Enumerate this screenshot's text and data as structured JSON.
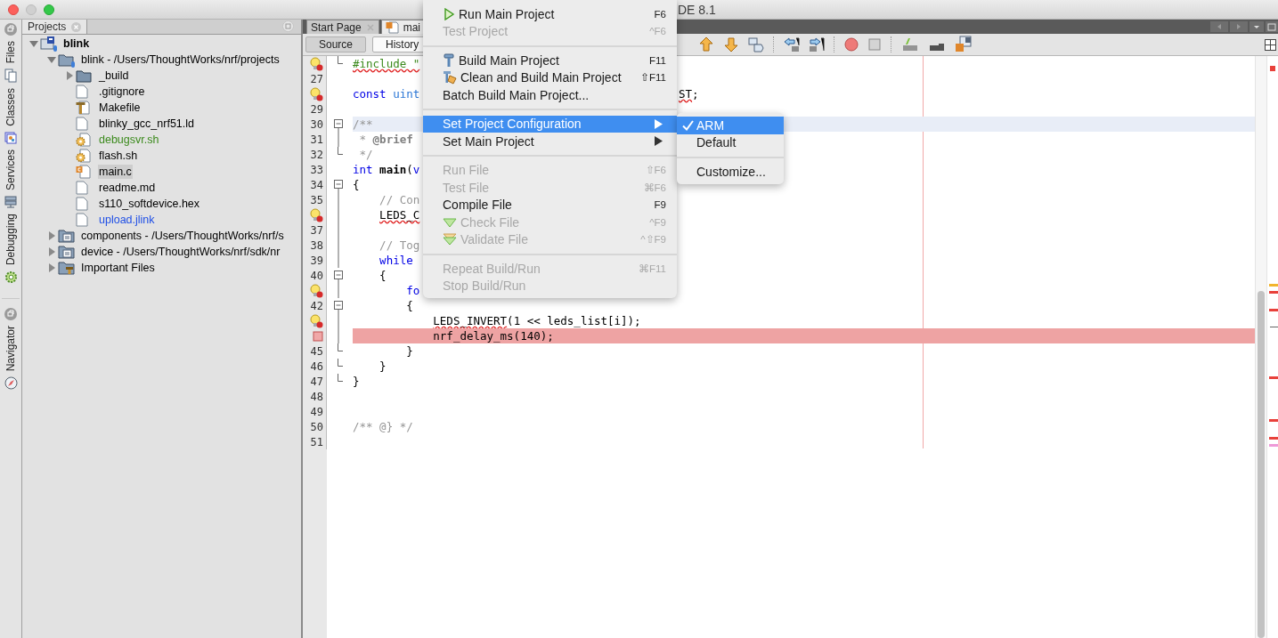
{
  "window": {
    "title": "DE 8.1"
  },
  "side_tabs": [
    {
      "label": "Files",
      "kind": "files"
    },
    {
      "label": "Classes",
      "kind": "classes"
    },
    {
      "label": "Services",
      "kind": "services"
    },
    {
      "label": "Debugging",
      "kind": "debugging"
    },
    {
      "label": "Navigator",
      "kind": "navigator"
    }
  ],
  "projects": {
    "title": "Projects",
    "tree": [
      {
        "label": "blink",
        "kind": "project",
        "expanded": true,
        "selected": false,
        "children": [
          {
            "label": "blink - /Users/ThoughtWorks/nrf/projects",
            "kind": "source-root",
            "expanded": true,
            "selected": false,
            "children": [
              {
                "label": "_build",
                "kind": "folder",
                "expanded": false,
                "selected": false
              },
              {
                "label": ".gitignore",
                "kind": "file",
                "selected": false
              },
              {
                "label": "Makefile",
                "kind": "makefile",
                "selected": false
              },
              {
                "label": "blinky_gcc_nrf51.ld",
                "kind": "file",
                "selected": false
              },
              {
                "label": "debugsvr.sh",
                "kind": "script",
                "color": "#3b8a1c",
                "selected": false
              },
              {
                "label": "flash.sh",
                "kind": "script",
                "selected": false
              },
              {
                "label": "main.c",
                "kind": "c-file",
                "selected": true
              },
              {
                "label": "readme.md",
                "kind": "file",
                "selected": false
              },
              {
                "label": "s110_softdevice.hex",
                "kind": "file",
                "selected": false
              },
              {
                "label": "upload.jlink",
                "kind": "file",
                "color": "#1f4fe6",
                "selected": false
              }
            ]
          },
          {
            "label": "components - /Users/ThoughtWorks/nrf/s",
            "kind": "library",
            "expanded": false,
            "selected": false
          },
          {
            "label": "device - /Users/ThoughtWorks/nrf/sdk/nr",
            "kind": "library",
            "expanded": false,
            "selected": false
          },
          {
            "label": "Important Files",
            "kind": "important",
            "expanded": false,
            "selected": false
          }
        ]
      }
    ]
  },
  "editor": {
    "tabs": [
      {
        "label": "Start Page",
        "selected": false,
        "kind": "page"
      },
      {
        "label": "mai",
        "selected": true,
        "kind": "c-file"
      }
    ],
    "views": [
      {
        "label": "Source",
        "selected": true
      },
      {
        "label": "History",
        "selected": false
      }
    ],
    "lines": [
      {
        "hint": true,
        "breakpoint": false,
        "fold_start": false,
        "fold_end": true,
        "current": false,
        "tokens": [
          {
            "text": "#include \"",
            "kind": "include-error"
          }
        ]
      },
      {
        "number": "27",
        "hint": false,
        "breakpoint": false,
        "fold_start": false,
        "fold_end": false,
        "current": false
      },
      {
        "hint": true,
        "breakpoint": false,
        "fold_start": false,
        "fold_end": false,
        "current": false,
        "tokens": [
          {
            "text": "const",
            "kind": "kw"
          },
          {
            "text": " uint",
            "kind": "type"
          }
        ],
        "tail": [
          {
            "text": "ST",
            "kind": "error"
          },
          {
            "text": ";",
            "kind": "plain"
          }
        ]
      },
      {
        "number": "29",
        "hint": false,
        "breakpoint": false,
        "fold_start": false,
        "fold_end": false,
        "current": false
      },
      {
        "number": "30",
        "hint": false,
        "breakpoint": false,
        "fold_start": true,
        "fold_end": false,
        "current": true,
        "tokens": [
          {
            "text": "/**",
            "kind": "comment"
          }
        ]
      },
      {
        "number": "31",
        "hint": false,
        "breakpoint": false,
        "fold_start": false,
        "fold_end": false,
        "current": false,
        "tokens": [
          {
            "text": " *",
            "kind": "comment"
          },
          {
            "text": " @brief",
            "kind": "doc-tag"
          }
        ]
      },
      {
        "number": "32",
        "hint": false,
        "breakpoint": false,
        "fold_start": false,
        "fold_end": true,
        "current": false,
        "tokens": [
          {
            "text": " */",
            "kind": "comment"
          }
        ]
      },
      {
        "number": "33",
        "hint": false,
        "breakpoint": false,
        "fold_start": false,
        "fold_end": false,
        "current": false,
        "tokens": [
          {
            "text": "int",
            "kind": "kw"
          },
          {
            "text": " main",
            "kind": "bold"
          },
          {
            "text": "(",
            "kind": "plain"
          },
          {
            "text": "v",
            "kind": "kw"
          }
        ]
      },
      {
        "number": "34",
        "hint": false,
        "breakpoint": false,
        "fold_start": true,
        "fold_end": false,
        "current": false,
        "tokens": [
          {
            "text": "{",
            "kind": "plain"
          }
        ]
      },
      {
        "number": "35",
        "hint": false,
        "breakpoint": false,
        "fold_start": false,
        "fold_end": false,
        "current": false,
        "tokens": [
          {
            "text": "    // Con",
            "kind": "comment"
          }
        ]
      },
      {
        "hint": true,
        "breakpoint": false,
        "fold_start": false,
        "fold_end": false,
        "current": false,
        "tokens": [
          {
            "text": "    LEDS_C",
            "kind": "error"
          }
        ]
      },
      {
        "number": "37",
        "hint": false,
        "breakpoint": false,
        "fold_start": false,
        "fold_end": false,
        "current": false
      },
      {
        "number": "38",
        "hint": false,
        "breakpoint": false,
        "fold_start": false,
        "fold_end": false,
        "current": false,
        "tokens": [
          {
            "text": "    // Tog",
            "kind": "comment"
          }
        ]
      },
      {
        "number": "39",
        "hint": false,
        "breakpoint": false,
        "fold_start": false,
        "fold_end": false,
        "current": false,
        "tokens": [
          {
            "text": "    while",
            "kind": "kw"
          }
        ]
      },
      {
        "number": "40",
        "hint": false,
        "breakpoint": false,
        "fold_start": true,
        "fold_end": false,
        "current": false,
        "tokens": [
          {
            "text": "    {",
            "kind": "plain"
          }
        ]
      },
      {
        "hint": true,
        "breakpoint": false,
        "fold_start": false,
        "fold_end": false,
        "current": false,
        "tokens": [
          {
            "text": "        fo",
            "kind": "kw"
          }
        ]
      },
      {
        "number": "42",
        "hint": false,
        "breakpoint": false,
        "fold_start": true,
        "fold_end": false,
        "current": false,
        "tokens": [
          {
            "text": "        {",
            "kind": "plain"
          }
        ]
      },
      {
        "hint": true,
        "breakpoint": false,
        "fold_start": false,
        "fold_end": false,
        "current": false,
        "tokens": [
          {
            "text": "            LEDS_INVERT",
            "kind": "error"
          },
          {
            "text": "(1 << leds_list[i]);",
            "kind": "plain"
          }
        ]
      },
      {
        "hint": false,
        "breakpoint": true,
        "fold_start": false,
        "fold_end": false,
        "current": false,
        "tokens": [
          {
            "text": "            nrf_delay_ms(140);",
            "kind": "plain"
          }
        ]
      },
      {
        "number": "45",
        "hint": false,
        "breakpoint": false,
        "fold_start": false,
        "fold_end": true,
        "current": false,
        "tokens": [
          {
            "text": "        }",
            "kind": "plain"
          }
        ]
      },
      {
        "number": "46",
        "hint": false,
        "breakpoint": false,
        "fold_start": false,
        "fold_end": true,
        "current": false,
        "tokens": [
          {
            "text": "    }",
            "kind": "plain"
          }
        ]
      },
      {
        "number": "47",
        "hint": false,
        "breakpoint": false,
        "fold_start": false,
        "fold_end": true,
        "current": false,
        "tokens": [
          {
            "text": "}",
            "kind": "plain"
          }
        ]
      },
      {
        "number": "48",
        "hint": false,
        "breakpoint": false,
        "fold_start": false,
        "fold_end": false,
        "current": false
      },
      {
        "number": "49",
        "hint": false,
        "breakpoint": false,
        "fold_start": false,
        "fold_end": false,
        "current": false
      },
      {
        "number": "50",
        "hint": false,
        "breakpoint": false,
        "fold_start": false,
        "fold_end": false,
        "current": false,
        "tokens": [
          {
            "text": "/** @} */",
            "kind": "comment"
          }
        ]
      },
      {
        "number": "51",
        "hint": false,
        "breakpoint": false,
        "fold_start": false,
        "fold_end": false,
        "current": false
      }
    ]
  },
  "menu": {
    "items": [
      {
        "kind": "item",
        "label": "Run Main Project",
        "shortcut": "F6",
        "disabled": false,
        "selected": false
      },
      {
        "kind": "item",
        "label": "Test Project",
        "shortcut": "^F6",
        "disabled": true,
        "selected": false
      },
      {
        "kind": "separator"
      },
      {
        "kind": "item",
        "label": "Build Main Project",
        "shortcut": "F11",
        "disabled": false,
        "selected": false
      },
      {
        "kind": "item",
        "label": "Clean and Build Main Project",
        "shortcut": "⇧F11",
        "disabled": false,
        "selected": false
      },
      {
        "kind": "item",
        "label": "Batch Build Main Project...",
        "disabled": false,
        "selected": false
      },
      {
        "kind": "separator"
      },
      {
        "kind": "item",
        "label": "Set Project Configuration",
        "submenu": true,
        "disabled": false,
        "selected": true
      },
      {
        "kind": "item",
        "label": "Set Main Project",
        "submenu": true,
        "disabled": false,
        "selected": false
      },
      {
        "kind": "separator"
      },
      {
        "kind": "item",
        "label": "Run File",
        "shortcut": "⇧F6",
        "disabled": true,
        "selected": false
      },
      {
        "kind": "item",
        "label": "Test File",
        "shortcut": "⌘F6",
        "disabled": true,
        "selected": false
      },
      {
        "kind": "item",
        "label": "Compile File",
        "shortcut": "F9",
        "disabled": false,
        "selected": false
      },
      {
        "kind": "item",
        "label": "Check File",
        "shortcut": "^F9",
        "disabled": true,
        "selected": false
      },
      {
        "kind": "item",
        "label": "Validate File",
        "shortcut": "^⇧F9",
        "disabled": true,
        "selected": false
      },
      {
        "kind": "separator"
      },
      {
        "kind": "item",
        "label": "Repeat Build/Run",
        "shortcut": "⌘F11",
        "disabled": true,
        "selected": false
      },
      {
        "kind": "item",
        "label": "Stop Build/Run",
        "disabled": true,
        "selected": false
      }
    ]
  },
  "submenu": {
    "items": [
      {
        "kind": "item",
        "label": "ARM",
        "checked": true,
        "selected": true
      },
      {
        "kind": "item",
        "label": "Default",
        "checked": false,
        "selected": false
      },
      {
        "kind": "separator"
      },
      {
        "kind": "item",
        "label": "Customize...",
        "checked": false,
        "selected": false
      }
    ]
  }
}
